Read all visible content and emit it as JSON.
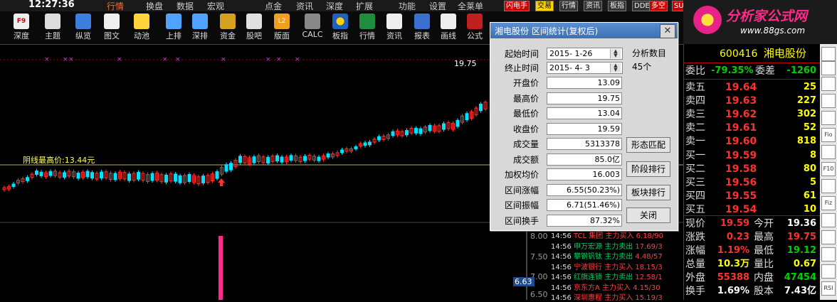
{
  "menubar": {
    "clock": "12:27:36",
    "items": [
      "行情",
      "换盘",
      "数据",
      "宏观",
      "点金",
      "资讯",
      "深度",
      "扩展",
      "功能",
      "设置",
      "全莱单"
    ],
    "tags": [
      "闪电手",
      "交易",
      "行情",
      "资讯",
      "板指",
      "DDE",
      "多空",
      "SUP"
    ]
  },
  "toolbar": {
    "items": [
      {
        "label": "深度",
        "icon": "f9-icon"
      },
      {
        "label": "主题",
        "icon": "home-icon"
      },
      {
        "label": "纵览",
        "icon": "overview-icon"
      },
      {
        "label": "图文",
        "icon": "picture-text-icon"
      },
      {
        "label": "动池",
        "icon": "pool-icon"
      },
      {
        "label": "上排",
        "icon": "upward-rank-icon"
      },
      {
        "label": "深排",
        "icon": "deep-rank-icon"
      },
      {
        "label": "资金",
        "icon": "funds-icon"
      },
      {
        "label": "股吧",
        "icon": "forum-icon"
      },
      {
        "label": "版面",
        "icon": "layout-icon"
      },
      {
        "label": "CALC",
        "icon": "calculator-icon"
      },
      {
        "label": "板指",
        "icon": "sector-index-icon"
      },
      {
        "label": "行情",
        "icon": "quote-icon"
      },
      {
        "label": "资讯",
        "icon": "news-icon"
      },
      {
        "label": "报表",
        "icon": "report-icon"
      },
      {
        "label": "画线",
        "icon": "draw-line-icon"
      },
      {
        "label": "公式",
        "icon": "formula-icon"
      }
    ]
  },
  "logo": {
    "title": "分析家公式网",
    "url": "www.88gs.com"
  },
  "chart": {
    "label": "阴线最高价:13.44元",
    "high_label": "19.75",
    "axis_labels": [
      "8.00",
      "7.50",
      "7.00",
      "6.50"
    ],
    "cursor_value": "6.63"
  },
  "trades": [
    {
      "time": "14:56",
      "name": "TCL 集团",
      "act": "主力买入",
      "value": "6.18/90",
      "dir": "buy"
    },
    {
      "time": "14:56",
      "name": "申万宏源",
      "act": "主力卖出",
      "value": "17.69/3",
      "dir": "sell"
    },
    {
      "time": "14:56",
      "name": "攀钢钒钛",
      "act": "主力卖出",
      "value": "4.48/57",
      "dir": "sell"
    },
    {
      "time": "14:56",
      "name": "宁波银行",
      "act": "主力买入",
      "value": "18.15/3",
      "dir": "buy"
    },
    {
      "time": "14:56",
      "name": "红旗连锁",
      "act": "主力卖出",
      "value": "12.58/1",
      "dir": "sell"
    },
    {
      "time": "14:56",
      "name": "京东方A",
      "act": "主力买入",
      "value": "4.15/30",
      "dir": "buy"
    },
    {
      "time": "14:56",
      "name": "深圳惠程",
      "act": "主力买入",
      "value": "15.19/3",
      "dir": "buy"
    }
  ],
  "dialog": {
    "title": "湘电股份  区间统计(复权后)",
    "close": "✕",
    "start_label": "起始时间",
    "start_value": "2015- 1-26",
    "end_label": "终止时间",
    "end_value": "2015- 4- 3",
    "count_label": "分析数目",
    "count_value": "45个",
    "fields": [
      {
        "label": "开盘价",
        "value": "13.09"
      },
      {
        "label": "最高价",
        "value": "19.75"
      },
      {
        "label": "最低价",
        "value": "13.04"
      },
      {
        "label": "收盘价",
        "value": "19.59"
      },
      {
        "label": "成交量",
        "value": "5313378"
      },
      {
        "label": "成交额",
        "value": "85.0亿"
      },
      {
        "label": "加权均价",
        "value": "16.003"
      },
      {
        "label": "区间涨幅",
        "value": "6.55(50.23%)"
      },
      {
        "label": "区间振幅",
        "value": "6.71(51.46%)"
      },
      {
        "label": "区间换手",
        "value": "87.32%"
      }
    ],
    "buttons": [
      "形态匹配",
      "阶段排行",
      "板块排行",
      "关闭"
    ]
  },
  "quote": {
    "code": "600416",
    "name": "湘电股份",
    "ratio_label": "委比",
    "ratio": "-79.35%",
    "diff_label": "委差",
    "diff": "-1260",
    "asks": [
      {
        "label": "卖五",
        "price": "19.64",
        "vol": "25"
      },
      {
        "label": "卖四",
        "price": "19.63",
        "vol": "227"
      },
      {
        "label": "卖三",
        "price": "19.62",
        "vol": "302"
      },
      {
        "label": "卖二",
        "price": "19.61",
        "vol": "52"
      },
      {
        "label": "卖一",
        "price": "19.60",
        "vol": "818"
      }
    ],
    "bids": [
      {
        "label": "买一",
        "price": "19.59",
        "vol": "8"
      },
      {
        "label": "买二",
        "price": "19.58",
        "vol": "80"
      },
      {
        "label": "买三",
        "price": "19.56",
        "vol": "5"
      },
      {
        "label": "买四",
        "price": "19.55",
        "vol": "61"
      },
      {
        "label": "买五",
        "price": "19.54",
        "vol": "10"
      }
    ],
    "stats": [
      {
        "l1": "现价",
        "v1": "19.59",
        "c1": "red",
        "l2": "今开",
        "v2": "19.36",
        "c2": "white"
      },
      {
        "l1": "涨跌",
        "v1": "0.23",
        "c1": "red",
        "l2": "最高",
        "v2": "19.75",
        "c2": "red"
      },
      {
        "l1": "涨幅",
        "v1": "1.19%",
        "c1": "red",
        "l2": "最低",
        "v2": "19.12",
        "c2": "green"
      },
      {
        "l1": "总量",
        "v1": "10.3万",
        "c1": "yellow",
        "l2": "量比",
        "v2": "0.67",
        "c2": "yellow"
      },
      {
        "l1": "外盘",
        "v1": "55388",
        "c1": "red",
        "l2": "内盘",
        "v2": "47454",
        "c2": "green"
      },
      {
        "l1": "换手",
        "v1": "1.69%",
        "c1": "white",
        "l2": "股本",
        "v2": "7.43亿",
        "c2": "white"
      }
    ]
  },
  "right_strip": [
    "Fio",
    "F10",
    "Fiz",
    "RSI"
  ]
}
